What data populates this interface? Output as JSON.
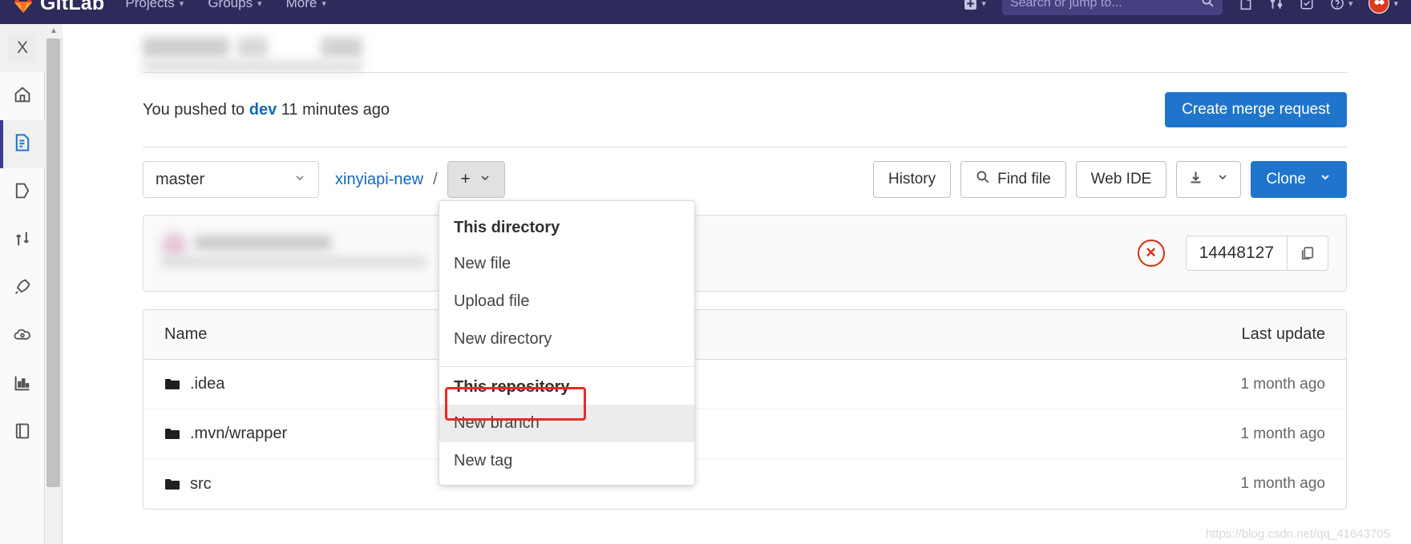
{
  "navbar": {
    "brand": "GitLab",
    "links": [
      {
        "label": "Projects",
        "caret": "chevron-down-icon"
      },
      {
        "label": "Groups",
        "caret": "chevron-down-icon"
      },
      {
        "label": "More",
        "caret": "chevron-down-icon"
      }
    ],
    "plus_menu_caret": "chevron-down-icon",
    "search_placeholder": "Search or jump to...",
    "icons": [
      "issues-icon",
      "merge-requests-icon",
      "todos-icon",
      "help-icon",
      "user-avatar"
    ]
  },
  "sidebar": {
    "items": [
      {
        "name": "project-avatar",
        "label": "X",
        "icon": "project-avatar",
        "state": "selected"
      },
      {
        "name": "project-overview",
        "label": "",
        "icon": "home-icon",
        "state": ""
      },
      {
        "name": "repository",
        "label": "",
        "icon": "repository-icon",
        "state": "active"
      },
      {
        "name": "issues",
        "label": "",
        "icon": "issues-icon",
        "state": ""
      },
      {
        "name": "merge-requests",
        "label": "",
        "icon": "merge-request-icon",
        "state": ""
      },
      {
        "name": "ci-cd",
        "label": "",
        "icon": "rocket-icon",
        "state": ""
      },
      {
        "name": "deployments",
        "label": "",
        "icon": "cloud-gear-icon",
        "state": ""
      },
      {
        "name": "analytics",
        "label": "",
        "icon": "chart-icon",
        "state": ""
      },
      {
        "name": "wiki",
        "label": "",
        "icon": "book-icon",
        "state": ""
      }
    ]
  },
  "activity": {
    "pushed_prefix": "You pushed to",
    "branch": "dev",
    "pushed_suffix": "11 minutes ago",
    "create_mr_label": "Create merge request"
  },
  "toolbar": {
    "branch_value": "master",
    "branch_caret": "chevron-down-icon",
    "repo_crumb": "xinyiapi-new",
    "crumb_separator": "/",
    "plus_label": "+",
    "plus_caret": "chevron-down-icon",
    "history_label": "History",
    "find_file_label": "Find file",
    "find_file_icon": "search-icon",
    "web_ide_label": "Web IDE",
    "download_icon": "download-icon",
    "download_caret": "chevron-down-icon",
    "clone_label": "Clone",
    "clone_caret": "chevron-down-icon"
  },
  "commit": {
    "pipeline_status": "failed",
    "pipeline_icon": "failed-circle-x-icon",
    "sha": "14448127",
    "copy_icon": "copy-icon"
  },
  "files": {
    "col_name": "Name",
    "col_last_update": "Last update",
    "rows": [
      {
        "name": ".idea",
        "icon": "folder-icon",
        "last_update": "1 month ago"
      },
      {
        "name": ".mvn/wrapper",
        "icon": "folder-icon",
        "last_update": "1 month ago"
      },
      {
        "name": "src",
        "icon": "folder-icon",
        "last_update": "1 month ago"
      }
    ]
  },
  "dropdown": {
    "section_directory": "This directory",
    "items_directory": [
      "New file",
      "Upload file",
      "New directory"
    ],
    "section_repository": "This repository",
    "items_repository": [
      "New branch",
      "New tag"
    ],
    "highlighted_item": "New branch"
  },
  "colors": {
    "navbar_bg": "#2e2a5b",
    "primary_blue": "#1f75cb",
    "link_blue": "#1068bf",
    "danger_red": "#dd2b0e",
    "annotation_red": "#ec2b24",
    "active_indigo": "#3c3a8f"
  },
  "watermark": "https://blog.csdn.net/qq_41643705"
}
